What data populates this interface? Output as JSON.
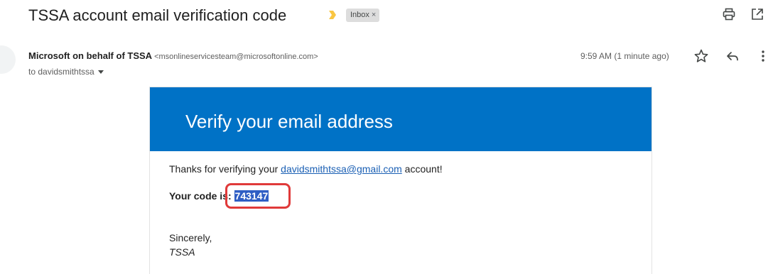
{
  "message": {
    "subject": "TSSA account email verification code",
    "label": "Inbox",
    "label_close": "×",
    "sender_name": "Microsoft on behalf of TSSA",
    "sender_email": "<msonlineservicesteam@microsoftonline.com>",
    "recipient": "to davidsmithtssa",
    "timestamp": "9:59 AM (1 minute ago)"
  },
  "email_body": {
    "banner_title": "Verify your email address",
    "thanks_prefix": "Thanks for verifying your ",
    "email_link": "davidsmithtssa@gmail.com",
    "thanks_suffix": " account!",
    "code_label": "Your code is: ",
    "code_value": "743147",
    "closing": "Sincerely,",
    "signature": "TSSA"
  },
  "icons": {
    "importance": "importance-marker-icon",
    "print": "print-icon",
    "open_new_window": "open-in-new-window-icon",
    "star": "star-icon",
    "reply": "reply-icon",
    "more": "more-vertical-icon"
  },
  "colors": {
    "banner": "#0072c6",
    "importance": "#f9c642",
    "link": "#1a5fb4",
    "code_highlight": "#2f5ec4",
    "annotation_box": "#e03a3a"
  }
}
